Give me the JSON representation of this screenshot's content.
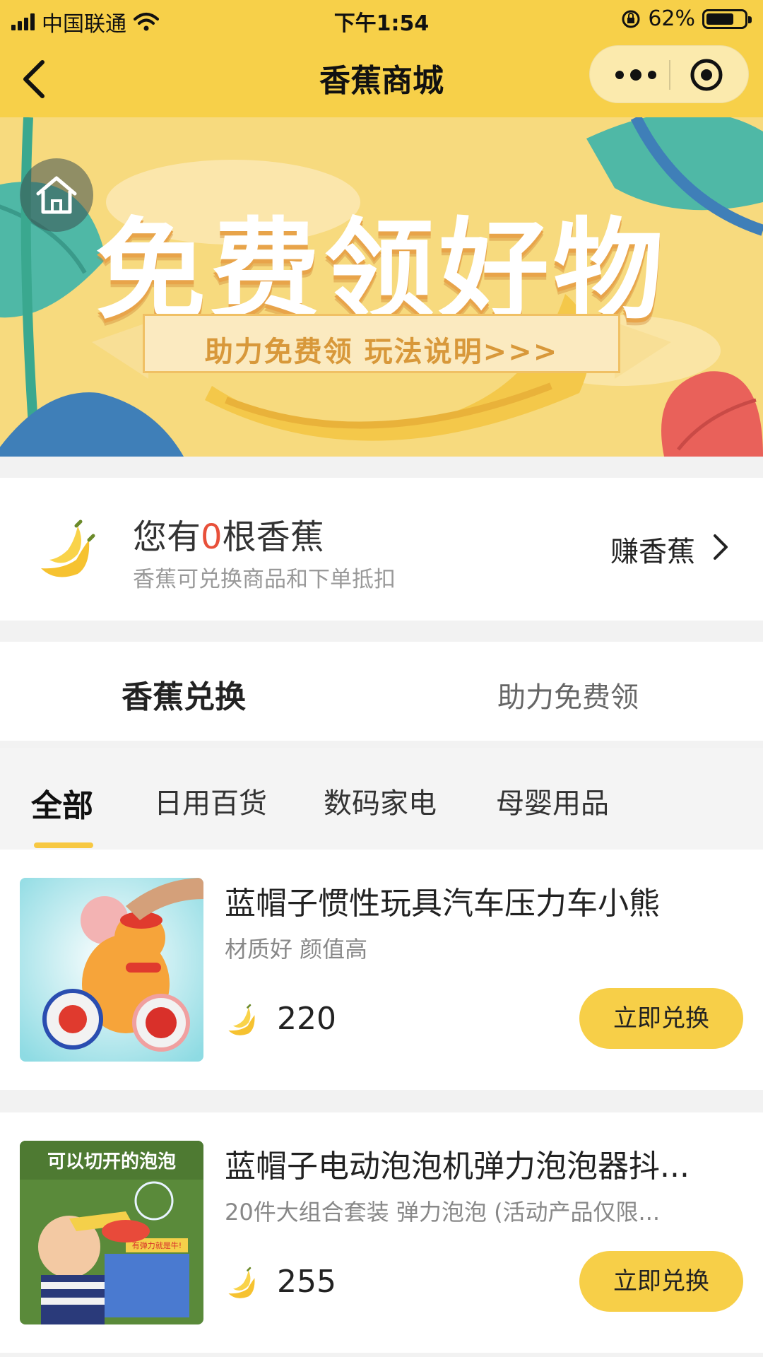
{
  "status_bar": {
    "carrier": "中国联通",
    "time": "下午1:54",
    "battery": "62%",
    "battery_level": 0.62
  },
  "nav": {
    "title": "香蕉商城"
  },
  "banner": {
    "title": "免费领好物",
    "ribbon_text": "助力免费领  玩法说明>>>"
  },
  "banana_info": {
    "prefix": "您有",
    "count": "0",
    "suffix": "根香蕉",
    "subtitle": "香蕉可兑换商品和下单抵扣",
    "earn_label": "赚香蕉"
  },
  "tabs": [
    {
      "label": "香蕉兑换",
      "active": true
    },
    {
      "label": "助力免费领",
      "active": false
    }
  ],
  "categories": [
    {
      "label": "全部",
      "active": true
    },
    {
      "label": "日用百货",
      "active": false
    },
    {
      "label": "数码家电",
      "active": false
    },
    {
      "label": "母婴用品",
      "active": false
    }
  ],
  "products": [
    {
      "name": "蓝帽子惯性玩具汽车压力车小熊",
      "desc": "材质好 颜值高",
      "price": "220",
      "button": "立即兑换"
    },
    {
      "name": "蓝帽子电动泡泡机弹力泡泡器抖...",
      "desc": "20件大组合套装 弹力泡泡 (活动产品仅限...",
      "price": "255",
      "button": "立即兑换",
      "image_text": "可以切开的泡泡",
      "image_badge": "有弹力就是牛!"
    }
  ],
  "colors": {
    "accent": "#f7d049",
    "button": "#f7cf48",
    "highlight": "#e8503a"
  }
}
